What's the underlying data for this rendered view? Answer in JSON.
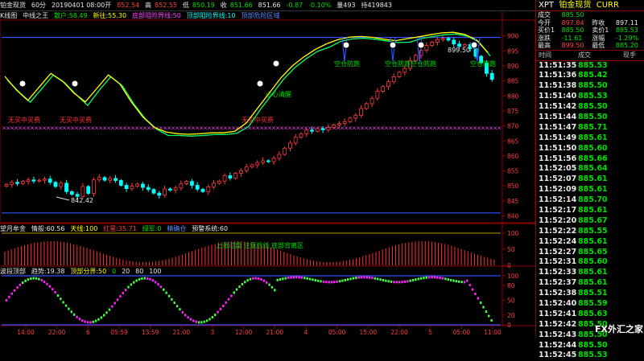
{
  "topbar": {
    "symbol": "铂金现货",
    "period": "60分",
    "date": "20190401 08:00开",
    "open_val": "852.54",
    "high_lbl": "高",
    "high_val": "852.55",
    "low_lbl": "低",
    "low_val": "850.19",
    "close_lbl": "收",
    "close_val": "851.66",
    "last": "851.66",
    "chg": "-0.87",
    "chgpct": "-0.10%",
    "vol": "量493",
    "oi": "持419843"
  },
  "panel1_legend": {
    "name": "K线图",
    "ind": "中线之王",
    "a": "散户:58.49",
    "b": "新往:55.30",
    "c": "底部阻险界线:50",
    "d": "顶部阻险界线:10",
    "e": "顶部危险区域"
  },
  "panel2_legend": {
    "name": "望月牟金",
    "a": "情般:60.56",
    "b": "天线:100",
    "c": "红星:35.71",
    "d": "绿军:0",
    "e": "精确仓",
    "f": "预警系统:60"
  },
  "panel3_legend": {
    "name": "波段顶部",
    "a": "趋势:19.38",
    "b": "顶部分界:50",
    "c": "0",
    "d": "20",
    "e": "80",
    "f": "100"
  },
  "annotations": {
    "low_price": "842.42",
    "high_price": "899.50",
    "no_buy_1": "无买中买费",
    "no_buy_2": "无买中买费",
    "no_buy_3": "无买中买费",
    "sell_1": "空仓防跑",
    "sell_2": "空仓防跑",
    "sell_3": "空仓防跑",
    "sell_4": "空仓防跑",
    "small_note": "小心清醒",
    "p2_note": "上涨过盘  注意后线  底部背离区"
  },
  "sidebar": {
    "code": "XPT",
    "name": "铂金现货",
    "suffix": "CURR",
    "rows": [
      {
        "l1": "成交",
        "v1": "885.50",
        "c1": "green",
        "l2": "",
        "v2": "",
        "c2": ""
      },
      {
        "l1": "今开",
        "v1": "897.84",
        "c1": "red",
        "l2": "昨收",
        "v2": "897.11",
        "c2": "white"
      },
      {
        "l1": "买价1",
        "v1": "885.50",
        "c1": "green",
        "l2": "卖价1",
        "v2": "885.53",
        "c2": "green"
      },
      {
        "l1": "涨跌",
        "v1": "-11.61",
        "c1": "green",
        "l2": "涨幅",
        "v2": "-1.29%",
        "c2": "green"
      },
      {
        "l1": "最高",
        "v1": "899.50",
        "c1": "red",
        "l2": "最低",
        "v2": "885.20",
        "c2": "green"
      }
    ],
    "col_time": "时间",
    "col_price": "成交",
    "col_vol": "现手",
    "ticks": [
      {
        "t": "11:51:35",
        "p": "885.53"
      },
      {
        "t": "11:51:36",
        "p": "885.42"
      },
      {
        "t": "11:51:38",
        "p": "885.50"
      },
      {
        "t": "11:51:40",
        "p": "885.53"
      },
      {
        "t": "11:51:42",
        "p": "885.50"
      },
      {
        "t": "11:51:44",
        "p": "885.50"
      },
      {
        "t": "11:51:47",
        "p": "885.71"
      },
      {
        "t": "11:51:49",
        "p": "885.61"
      },
      {
        "t": "11:51:50",
        "p": "885.60"
      },
      {
        "t": "11:51:56",
        "p": "885.66"
      },
      {
        "t": "11:52:05",
        "p": "885.64"
      },
      {
        "t": "11:52:07",
        "p": "885.61"
      },
      {
        "t": "11:52:09",
        "p": "885.61"
      },
      {
        "t": "11:52:14",
        "p": "885.70"
      },
      {
        "t": "11:52:17",
        "p": "885.61"
      },
      {
        "t": "11:52:20",
        "p": "885.67"
      },
      {
        "t": "11:52:22",
        "p": "885.55"
      },
      {
        "t": "11:52:24",
        "p": "885.61"
      },
      {
        "t": "11:52:27",
        "p": "885.65"
      },
      {
        "t": "11:52:31",
        "p": "885.60"
      },
      {
        "t": "11:52:33",
        "p": "885.61"
      },
      {
        "t": "11:52:37",
        "p": "885.61"
      },
      {
        "t": "11:52:38",
        "p": "885.51"
      },
      {
        "t": "11:52:40",
        "p": "885.59"
      },
      {
        "t": "11:52:41",
        "p": "885.63"
      },
      {
        "t": "11:52:42",
        "p": "885.50"
      },
      {
        "t": "11:52:43",
        "p": "885.50"
      },
      {
        "t": "11:52:44",
        "p": "885.50"
      },
      {
        "t": "11:52:45",
        "p": "885.53"
      }
    ],
    "ticks_v": [
      "",
      "",
      "",
      "",
      "",
      "",
      "",
      "",
      "",
      "",
      "",
      "",
      "",
      "",
      "",
      "",
      "",
      "",
      "",
      "",
      "",
      "",
      "",
      "",
      "",
      "",
      "",
      "",
      ""
    ],
    "watermark": "FX外汇之家"
  },
  "chart_data": [
    {
      "type": "candlestick",
      "y_axis_ticks": [
        "900",
        "895",
        "890",
        "885",
        "880",
        "875",
        "870",
        "865",
        "860",
        "855",
        "850",
        "845",
        "840"
      ],
      "ylim": [
        838,
        905
      ],
      "candles_close": [
        850.5,
        851.2,
        850.8,
        851.5,
        852.0,
        851.6,
        851.9,
        852.3,
        851.2,
        849.8,
        850.9,
        848.1,
        847.2,
        846.5,
        849.8,
        847.5,
        852.0,
        852.8,
        851.9,
        852.5,
        851.8,
        850.2,
        849.1,
        849.9,
        850.6,
        849.5,
        848.8,
        847.6,
        846.9,
        849.0,
        848.6,
        849.3,
        850.7,
        851.5,
        850.2,
        848.9,
        848.1,
        849.7,
        850.9,
        851.6,
        853.4,
        852.6,
        854.2,
        855.1,
        856.3,
        857.0,
        857.8,
        858.4,
        858.1,
        859.2,
        860.5,
        862.6,
        864.3,
        866.2,
        867.4,
        868.6,
        868.2,
        869.1,
        868.7,
        869.5,
        870.3,
        870.8,
        871.4,
        872.6,
        873.5,
        875.8,
        877.4,
        879.2,
        881.5,
        883.1,
        884.7,
        886.4,
        887.9,
        889.2,
        891.8,
        893.5,
        895.2,
        896.8,
        897.9,
        898.8,
        899.2,
        898.6,
        897.3,
        896.5,
        897.1,
        895.8,
        893.2,
        891.0,
        887.5,
        885.5
      ],
      "y_annotations": [
        "842.42",
        "899.50"
      ]
    },
    {
      "type": "bar",
      "ylim": [
        0,
        100
      ],
      "y_axis_ticks": [
        "100",
        "50",
        "0"
      ]
    },
    {
      "type": "line",
      "ylim": [
        0,
        100
      ],
      "y_axis_ticks": [
        "100",
        "80",
        "50",
        "20",
        "0"
      ],
      "x_axis_ticks": [
        "14:00",
        "22:00",
        "6",
        "05:59",
        "13:59",
        "21:00",
        "3",
        "12:00",
        "21:00",
        "4",
        "05:00",
        "15:00",
        "22:00",
        "5",
        "05:00",
        "11:00"
      ]
    }
  ]
}
